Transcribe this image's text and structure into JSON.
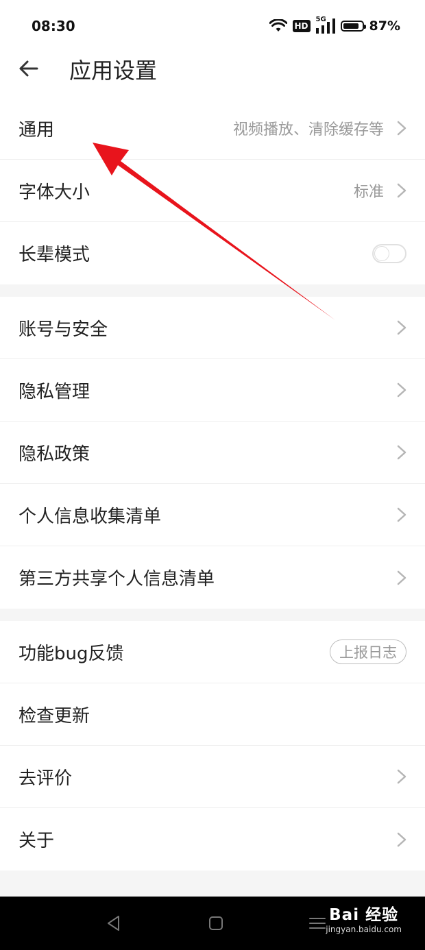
{
  "status_bar": {
    "time": "08:30",
    "network_badge": "HD",
    "signal_label": "5G",
    "battery_percent_text": "87%",
    "battery_level": 0.87
  },
  "header": {
    "title": "应用设置"
  },
  "groups": [
    {
      "items": [
        {
          "label": "通用",
          "value": "视频播放、清除缓存等",
          "control": "chevron"
        },
        {
          "label": "字体大小",
          "value": "标准",
          "control": "chevron"
        },
        {
          "label": "长辈模式",
          "control": "toggle",
          "toggle_on": false
        }
      ]
    },
    {
      "items": [
        {
          "label": "账号与安全",
          "control": "chevron"
        },
        {
          "label": "隐私管理",
          "control": "chevron"
        },
        {
          "label": "隐私政策",
          "control": "chevron"
        },
        {
          "label": "个人信息收集清单",
          "control": "chevron"
        },
        {
          "label": "第三方共享个人信息清单",
          "control": "chevron"
        }
      ]
    },
    {
      "items": [
        {
          "label": "功能bug反馈",
          "control": "button",
          "button_label": "上报日志"
        },
        {
          "label": "检查更新",
          "control": "none"
        },
        {
          "label": "去评价",
          "control": "chevron"
        },
        {
          "label": "关于",
          "control": "chevron"
        }
      ]
    }
  ],
  "watermark": {
    "logo": "Bai 经验",
    "url": "jingyan.baidu.com"
  },
  "colors": {
    "annotation_arrow": "#e8141c",
    "secondary_text": "#9a9a9a",
    "divider": "#efefef"
  }
}
